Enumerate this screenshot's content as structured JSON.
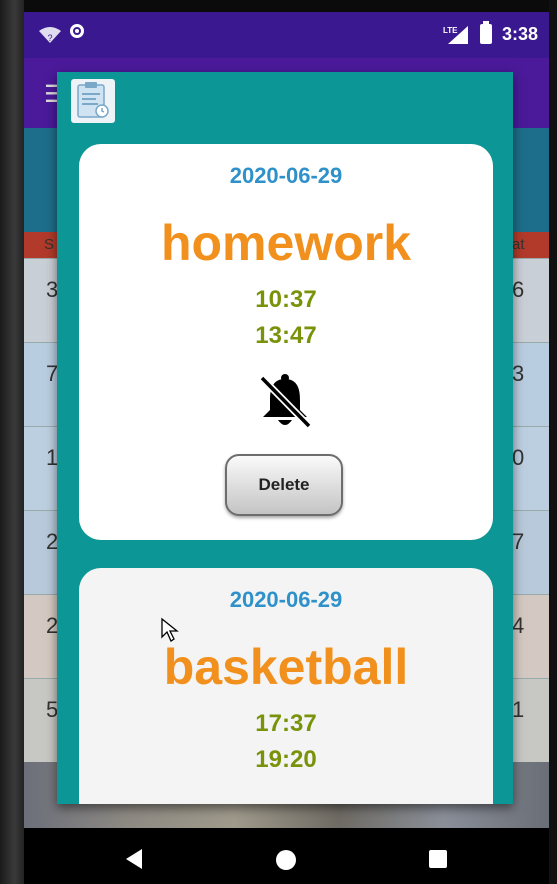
{
  "status_bar": {
    "time": "3:38",
    "network": "LTE",
    "icons": [
      "wifi-icon",
      "record-icon",
      "signal-icon",
      "battery-icon"
    ]
  },
  "background_calendar": {
    "weekday_first": "S",
    "weekday_last": "at",
    "left_numbers": [
      "3",
      "7",
      "1",
      "2",
      "2",
      "5"
    ],
    "right_numbers": [
      "6",
      "3",
      "0",
      "7",
      "4",
      "1"
    ]
  },
  "dialog": {
    "icon": "schedule-app-icon",
    "events": [
      {
        "date": "2020-06-29",
        "title": "homework",
        "start_time": "10:37",
        "end_time": "13:47",
        "alarm_icon": "bell-off-icon",
        "delete_label": "Delete"
      },
      {
        "date": "2020-06-29",
        "title": "basketball",
        "start_time": "17:37",
        "end_time": "19:20"
      }
    ]
  },
  "colors": {
    "dialog_bg": "#0d9696",
    "date": "#2f91c9",
    "title": "#f2901d",
    "time": "#78930a",
    "status_bar": "#3a1890"
  },
  "nav_bar": {
    "buttons": [
      "back-icon",
      "home-icon",
      "recents-icon"
    ]
  }
}
